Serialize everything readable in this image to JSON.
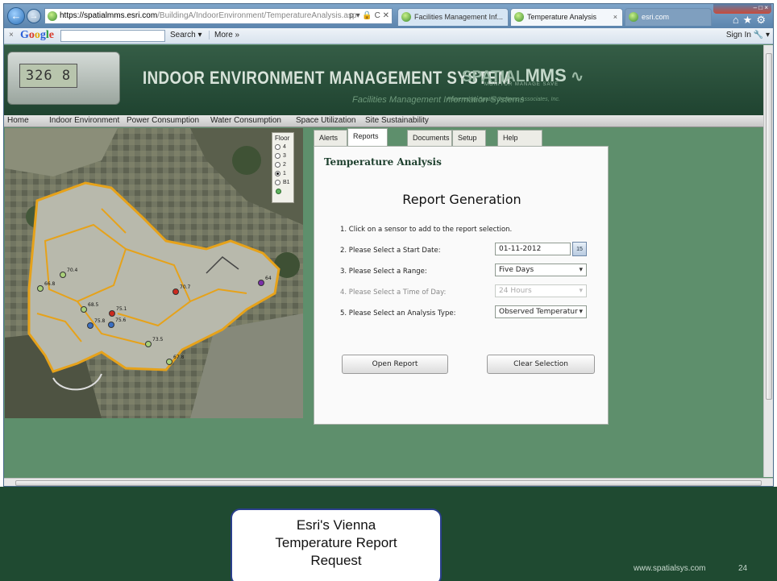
{
  "browser": {
    "address": {
      "host": "https://spatialmms.esri.com",
      "path": "/BuildingA/IndoorEnvironment/TemperatureAnalysis.asp"
    },
    "address_tools": "ρ ▾ 🔒 C ✕",
    "tabs": [
      {
        "label": "Facilities Management Inf..."
      },
      {
        "label": "Temperature Analysis"
      },
      {
        "label": "esri.com"
      }
    ],
    "toolbar": {
      "close": "×",
      "google": [
        "G",
        "o",
        "o",
        "g",
        "l",
        "e"
      ],
      "search": "Search ▾",
      "more": "More »",
      "signin": "Sign In 🔧 ▾"
    }
  },
  "header": {
    "thermostat_display": "326 8",
    "title": "INDOOR ENVIRONMENT MANAGEMENT SYSTEM",
    "subtitle": "Facilities Management Information Systems",
    "brand_prefix": "SPATIAL",
    "brand_mms": "MMS",
    "brand_tagline": "MONITOR MANAGE SAVE",
    "powered_by": "Powered by Spatial Systems Associates, Inc."
  },
  "nav": [
    "Home",
    "Indoor Environment",
    "Power Consumption",
    "Water Consumption",
    "Space Utilization",
    "Site Sustainability"
  ],
  "floor_panel": {
    "title": "Floor",
    "options": [
      {
        "label": "4",
        "selected": false
      },
      {
        "label": "3",
        "selected": false
      },
      {
        "label": "2",
        "selected": false
      },
      {
        "label": "1",
        "selected": true
      },
      {
        "label": "B1",
        "selected": false
      }
    ]
  },
  "sensors": [
    {
      "label": "64",
      "color": "#7b2fa8"
    },
    {
      "label": "70.7",
      "color": "#cc2a1e"
    },
    {
      "label": "75.1",
      "color": "#cc2a1e"
    },
    {
      "label": "75.6",
      "color": "#3a6fc2"
    },
    {
      "label": "75.8",
      "color": "#3a6fc2"
    },
    {
      "label": "66.8",
      "color": "#a9d07a"
    },
    {
      "label": "68.5",
      "color": "#a9d07a"
    },
    {
      "label": "70.4",
      "color": "#a9d07a"
    },
    {
      "label": "73.5",
      "color": "#a9d07a"
    },
    {
      "label": "67.8",
      "color": "#a9d07a"
    }
  ],
  "panel": {
    "tabs": [
      "Alerts",
      "Reports",
      "Documents",
      "Setup",
      "Help"
    ],
    "active_tab": "Reports",
    "title": "Temperature Analysis",
    "heading": "Report Generation",
    "steps": [
      "1.  Click on a sensor to add to the report selection.",
      "2.  Please Select a Start Date:",
      "3.  Please Select a Range:",
      "4.  Please Select a Time of Day:",
      "5.  Please Select an Analysis Type:"
    ],
    "start_date": "01-11-2012",
    "calendar_label": "15",
    "range": "Five Days",
    "time_of_day": "24 Hours",
    "analysis_type": "Observed Temperatur",
    "open_report": "Open Report",
    "clear_selection": "Clear Selection"
  },
  "slide": {
    "callout": [
      "Esri's Vienna",
      "Temperature Report",
      "Request"
    ],
    "url": "www.spatialsys.com",
    "page": "24"
  }
}
